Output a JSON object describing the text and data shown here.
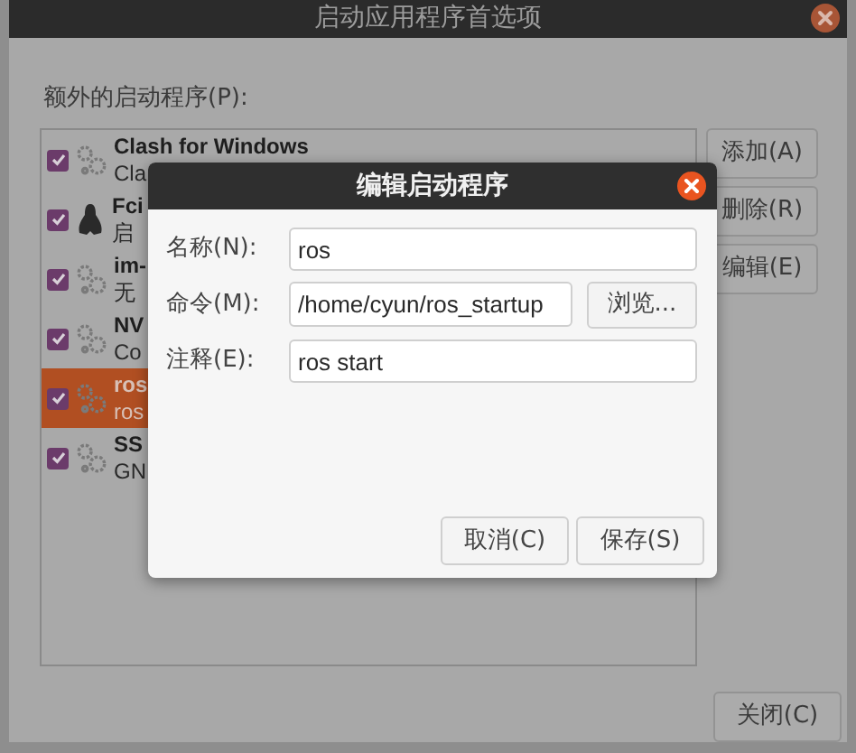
{
  "window": {
    "title": "启动应用程序首选项"
  },
  "list_label": "额外的启动程序(P):",
  "programs": [
    {
      "name": "Clash for Windows",
      "description": "Cla",
      "kind": "gear",
      "checked": true,
      "selected": false
    },
    {
      "name": "Fci",
      "description": "启",
      "kind": "penguin",
      "checked": true,
      "selected": false
    },
    {
      "name": "im-",
      "description": "无",
      "kind": "gear",
      "checked": true,
      "selected": false
    },
    {
      "name": "NV",
      "description": "Co",
      "kind": "gear",
      "checked": true,
      "selected": false
    },
    {
      "name": "ros",
      "description": "ros",
      "kind": "gear",
      "checked": true,
      "selected": true
    },
    {
      "name": "SS",
      "description": "GN",
      "kind": "gear",
      "checked": true,
      "selected": false
    }
  ],
  "side_buttons": [
    "添加(A)",
    "删除(R)",
    "编辑(E)"
  ],
  "close_button": "关闭(C)",
  "dialog": {
    "title": "编辑启动程序",
    "fields": [
      {
        "label": "名称(N):",
        "value": "ros",
        "kind": "text"
      },
      {
        "label": "命令(M):",
        "value": "/home/cyun/ros_startup",
        "kind": "browse",
        "button": "浏览..."
      },
      {
        "label": "注释(E):",
        "value": "ros start",
        "kind": "text"
      }
    ],
    "buttons": [
      "取消(C)",
      "保存(S)"
    ]
  }
}
